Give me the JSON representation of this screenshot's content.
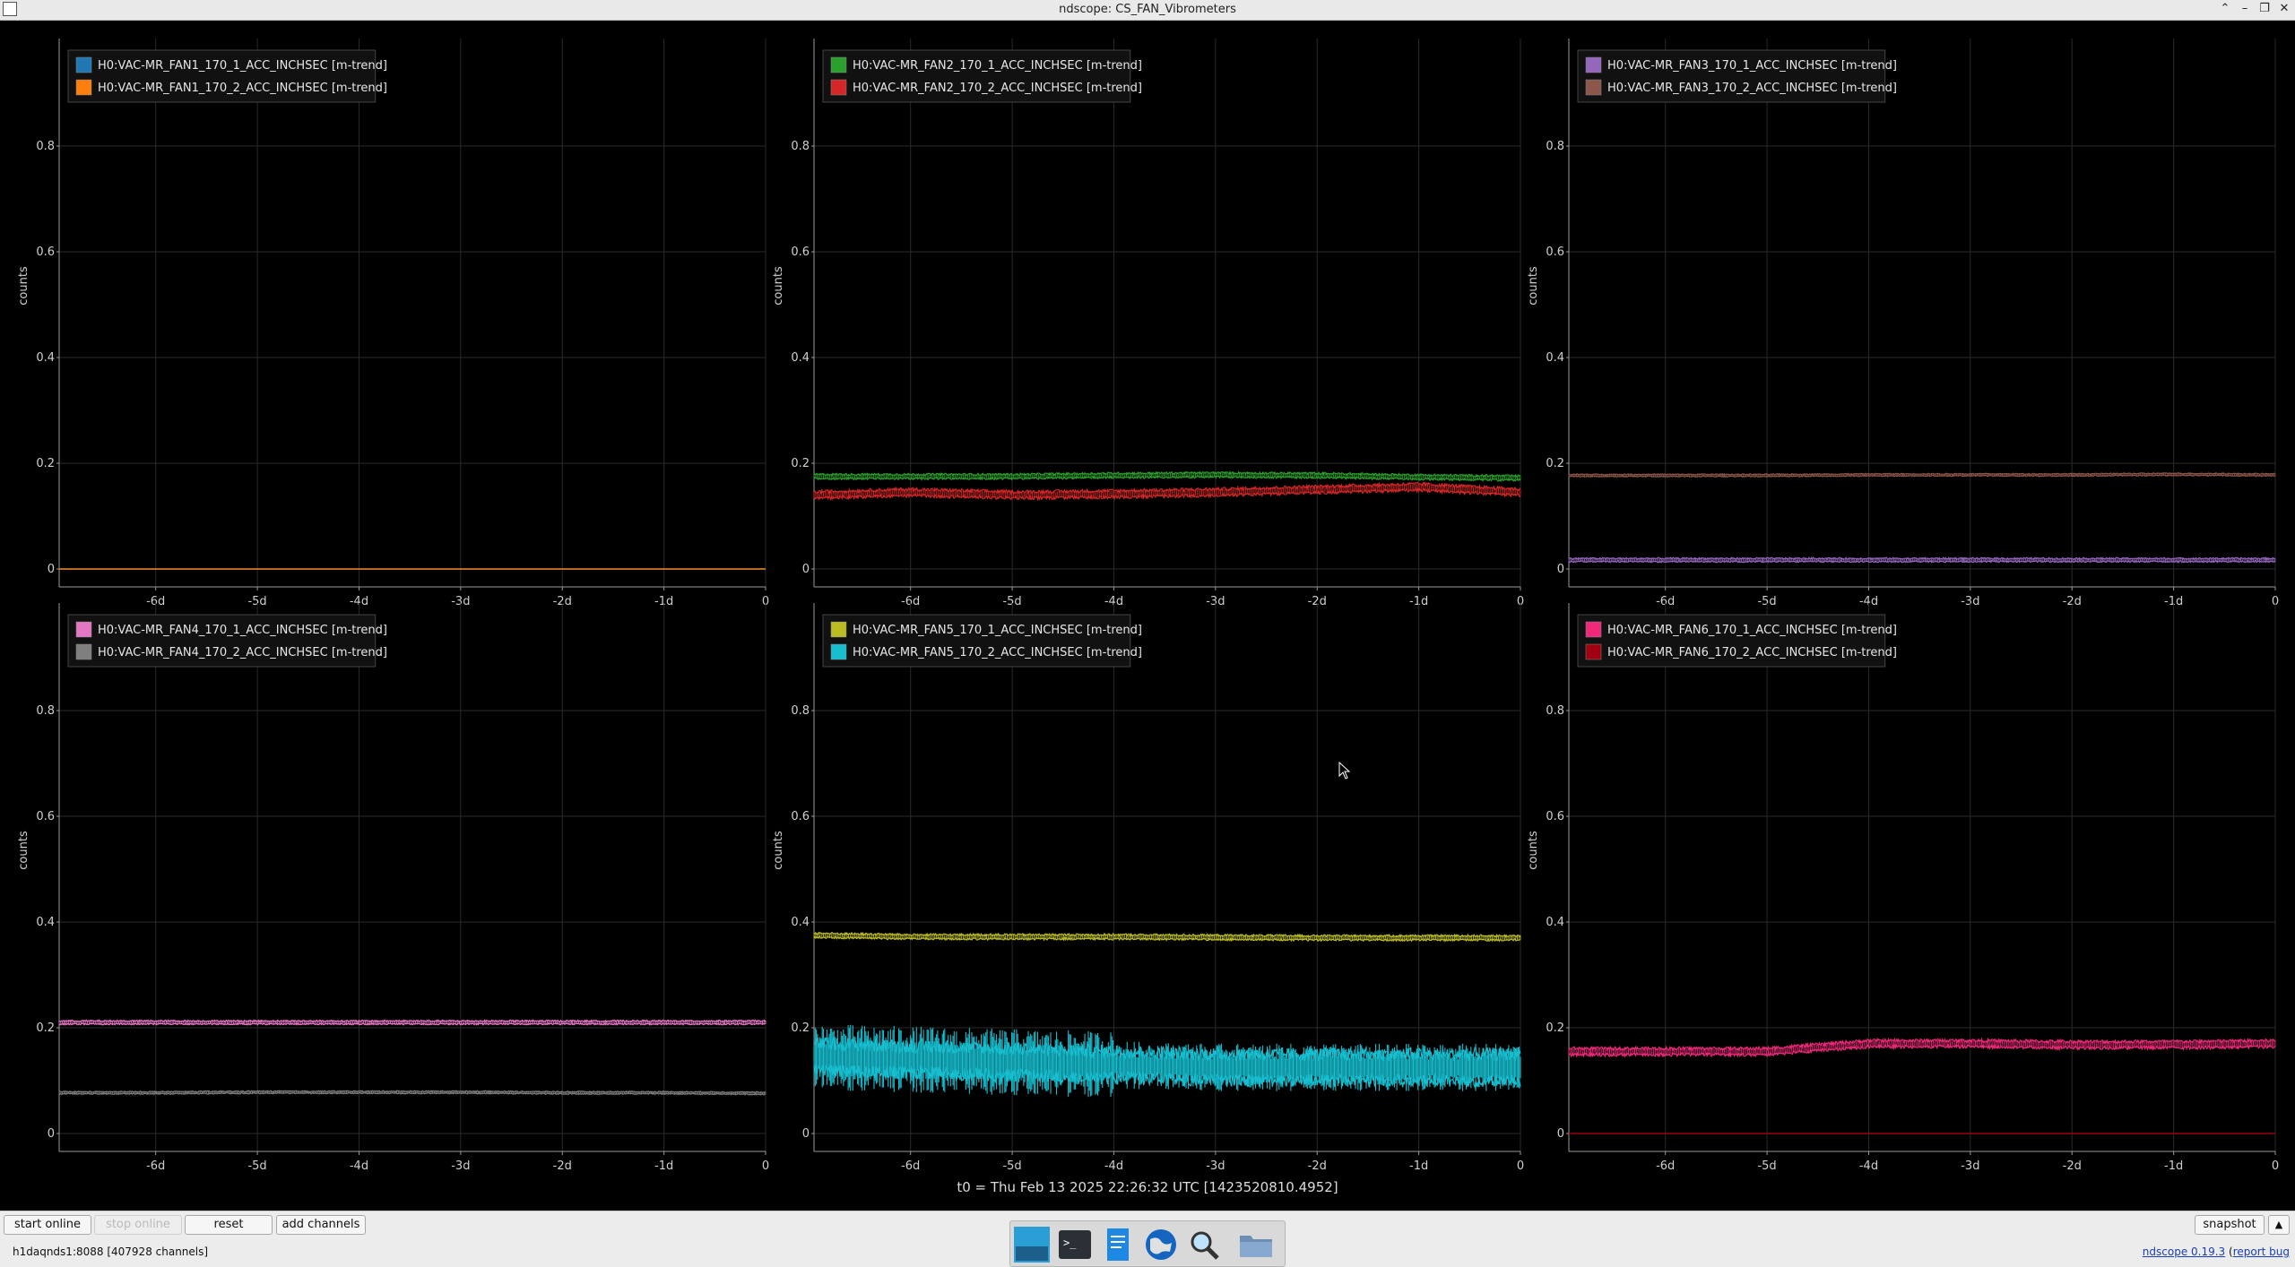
{
  "window": {
    "title": "ndscope: CS_FAN_Vibrometers"
  },
  "plots": [
    {
      "ylabel": "counts",
      "legend": [
        "H0:VAC-MR_FAN1_170_1_ACC_INCHSEC [m-trend]",
        "H0:VAC-MR_FAN1_170_2_ACC_INCHSEC [m-trend]"
      ],
      "colors": [
        "#1f77b4",
        "#ff7f0e"
      ]
    },
    {
      "ylabel": "counts",
      "legend": [
        "H0:VAC-MR_FAN2_170_1_ACC_INCHSEC [m-trend]",
        "H0:VAC-MR_FAN2_170_2_ACC_INCHSEC [m-trend]"
      ],
      "colors": [
        "#2ca02c",
        "#d62728"
      ]
    },
    {
      "ylabel": "counts",
      "legend": [
        "H0:VAC-MR_FAN3_170_1_ACC_INCHSEC [m-trend]",
        "H0:VAC-MR_FAN3_170_2_ACC_INCHSEC [m-trend]"
      ],
      "colors": [
        "#9467bd",
        "#8c564b"
      ]
    },
    {
      "ylabel": "counts",
      "legend": [
        "H0:VAC-MR_FAN4_170_1_ACC_INCHSEC [m-trend]",
        "H0:VAC-MR_FAN4_170_2_ACC_INCHSEC [m-trend]"
      ],
      "colors": [
        "#e377c2",
        "#7f7f7f"
      ]
    },
    {
      "ylabel": "counts",
      "legend": [
        "H0:VAC-MR_FAN5_170_1_ACC_INCHSEC [m-trend]",
        "H0:VAC-MR_FAN5_170_2_ACC_INCHSEC [m-trend]"
      ],
      "colors": [
        "#bcbd22",
        "#17becf"
      ]
    },
    {
      "ylabel": "counts",
      "legend": [
        "H0:VAC-MR_FAN6_170_1_ACC_INCHSEC [m-trend]",
        "H0:VAC-MR_FAN6_170_2_ACC_INCHSEC [m-trend]"
      ],
      "colors": [
        "#f0287a",
        "#a00010"
      ]
    }
  ],
  "axes": {
    "yticks": [
      "0",
      "0.2",
      "0.4",
      "0.6",
      "0.8"
    ],
    "xticks": [
      "-6d",
      "-5d",
      "-4d",
      "-3d",
      "-2d",
      "-1d",
      "0"
    ]
  },
  "chart_data": [
    {
      "type": "line",
      "series": [
        {
          "name": "H0:VAC-MR_FAN1_170_1_ACC_INCHSEC [m-trend]",
          "values": [
            0.0,
            0.0
          ]
        },
        {
          "name": "H0:VAC-MR_FAN1_170_2_ACC_INCHSEC [m-trend]",
          "values": [
            0.0,
            0.0
          ]
        }
      ],
      "x": [
        -6.95,
        0
      ],
      "ylabel": "counts",
      "ylim": [
        -0.03,
        1.0
      ],
      "xlim": [
        -6.95,
        0
      ]
    },
    {
      "type": "line",
      "series": [
        {
          "name": "H0:VAC-MR_FAN2_170_1_ACC_INCHSEC [m-trend]",
          "values": [
            0.175,
            0.175,
            0.175,
            0.177,
            0.178,
            0.177,
            0.174,
            0.172
          ]
        },
        {
          "name": "H0:VAC-MR_FAN2_170_2_ACC_INCHSEC [m-trend]",
          "values": [
            0.14,
            0.145,
            0.14,
            0.142,
            0.145,
            0.15,
            0.155,
            0.145
          ]
        }
      ],
      "x": [
        -6.95,
        -6,
        -5,
        -4,
        -3,
        -2,
        -1,
        0
      ],
      "ylabel": "counts",
      "ylim": [
        -0.03,
        1.0
      ],
      "xlim": [
        -6.95,
        0
      ]
    },
    {
      "type": "line",
      "series": [
        {
          "name": "H0:VAC-MR_FAN3_170_1_ACC_INCHSEC [m-trend]",
          "values": [
            0.017,
            0.017,
            0.017,
            0.017,
            0.017,
            0.017,
            0.017,
            0.017
          ]
        },
        {
          "name": "H0:VAC-MR_FAN3_170_2_ACC_INCHSEC [m-trend]",
          "values": [
            0.177,
            0.177,
            0.177,
            0.178,
            0.178,
            0.178,
            0.179,
            0.178
          ]
        }
      ],
      "x": [
        -6.95,
        -6,
        -5,
        -4,
        -3,
        -2,
        -1,
        0
      ],
      "ylabel": "counts",
      "ylim": [
        -0.03,
        1.0
      ],
      "xlim": [
        -6.95,
        0
      ]
    },
    {
      "type": "line",
      "series": [
        {
          "name": "H0:VAC-MR_FAN4_170_1_ACC_INCHSEC [m-trend]",
          "values": [
            0.21,
            0.21,
            0.21,
            0.21,
            0.21,
            0.21,
            0.21,
            0.21
          ]
        },
        {
          "name": "H0:VAC-MR_FAN4_170_2_ACC_INCHSEC [m-trend]",
          "values": [
            0.077,
            0.077,
            0.078,
            0.078,
            0.078,
            0.077,
            0.077,
            0.076
          ]
        }
      ],
      "x": [
        -6.95,
        -6,
        -5,
        -4,
        -3,
        -2,
        -1,
        0
      ],
      "ylabel": "counts",
      "ylim": [
        -0.03,
        1.0
      ],
      "xlim": [
        -6.95,
        0
      ]
    },
    {
      "type": "line",
      "series": [
        {
          "name": "H0:VAC-MR_FAN5_170_1_ACC_INCHSEC [m-trend]",
          "values": [
            0.375,
            0.372,
            0.372,
            0.372,
            0.371,
            0.37,
            0.37,
            0.37
          ]
        },
        {
          "name": "H0:VAC-MR_FAN5_170_2_ACC_INCHSEC [m-trend]",
          "values": [
            0.145,
            0.14,
            0.135,
            0.13,
            0.125,
            0.125,
            0.125,
            0.125
          ]
        }
      ],
      "x": [
        -6.95,
        -6,
        -5,
        -4,
        -3,
        -2,
        -1,
        0
      ],
      "ylabel": "counts",
      "ylim": [
        -0.03,
        1.0
      ],
      "xlim": [
        -6.95,
        0
      ]
    },
    {
      "type": "line",
      "series": [
        {
          "name": "H0:VAC-MR_FAN6_170_1_ACC_INCHSEC [m-trend]",
          "values": [
            0.155,
            0.155,
            0.155,
            0.17,
            0.17,
            0.168,
            0.168,
            0.17
          ]
        },
        {
          "name": "H0:VAC-MR_FAN6_170_2_ACC_INCHSEC [m-trend]",
          "values": [
            0.0,
            0.0,
            0.0,
            0.0,
            0.0,
            0.0,
            0.0,
            0.0
          ]
        }
      ],
      "x": [
        -6.95,
        -6,
        -5,
        -4,
        -3,
        -2,
        -1,
        0
      ],
      "ylabel": "counts",
      "ylim": [
        -0.03,
        1.0
      ],
      "xlim": [
        -6.95,
        0
      ]
    }
  ],
  "t0": "t0 = Thu Feb 13 2025 22:26:32 UTC [1423520810.4952]",
  "toolbar": {
    "start_online": "start online",
    "stop_online": "stop online",
    "reset": "reset",
    "add_channels": "add channels",
    "snapshot": "snapshot"
  },
  "status": {
    "server": "h1daqnds1:8088  [407928 channels]",
    "version_link": "ndscope 0.19.3",
    "report_link": "report bug"
  },
  "taskbar": [
    "desktop-icon",
    "terminal-icon",
    "text-editor-icon",
    "web-browser-icon",
    "search-icon",
    "folder-icon"
  ]
}
